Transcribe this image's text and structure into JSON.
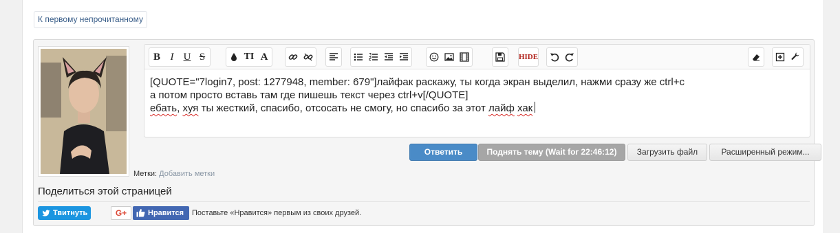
{
  "nav": {
    "unread_link": "К первому непрочитанному"
  },
  "toolbar": {
    "bold": "B",
    "italic": "I",
    "underline": "U",
    "strike": "S",
    "font_size": "TI",
    "font_family": "A",
    "hide": "HIDE",
    "icons": [
      "bold-icon",
      "italic-icon",
      "underline-icon",
      "strikethrough-icon",
      "text-color-icon",
      "font-size-icon",
      "font-family-icon",
      "link-icon",
      "unlink-icon",
      "align-left-icon",
      "bullet-list-icon",
      "numbered-list-icon",
      "outdent-icon",
      "indent-icon",
      "smiley-icon",
      "image-icon",
      "media-icon",
      "save-draft-icon",
      "hide-icon",
      "undo-icon",
      "redo-icon",
      "eraser-icon",
      "insert-icon",
      "settings-wrench-icon"
    ]
  },
  "editor": {
    "line1": "[QUOTE=\"7login7, post: 1277948, member: 679\"]лайфак раскажу, ты когда экран выделил, нажми сразу же ctrl+c",
    "line2": "а потом просто вставь там где пишешь текст через ctrl+v[/QUOTE]",
    "line3_w1": "ебать",
    "line3_s1": ", ",
    "line3_w2": "хуя",
    "line3_s2": " ты жесткий, спасибо, отсосать не смогу, но спасибо за этот ",
    "line3_w3": "лайф",
    "line3_s3": " ",
    "line3_w4": "хак"
  },
  "actions": {
    "reply": "Ответить",
    "bump": "Поднять тему  (Wait for 22:46:12)",
    "upload": "Загрузить файл",
    "advanced": "Расширенный режим..."
  },
  "tags": {
    "label": "Метки:",
    "add_link": "Добавить метки"
  },
  "share": {
    "title": "Поделиться этой страницей",
    "tweet": "Твитнуть",
    "gplus": "G+",
    "fb_like": "Нравится",
    "fb_text": "Поставьте «Нравится» первым из своих друзей."
  },
  "colors": {
    "primary": "#4a8bc7",
    "twitter": "#1b95e0",
    "facebook": "#4267b2",
    "link": "#3b5f8a"
  }
}
